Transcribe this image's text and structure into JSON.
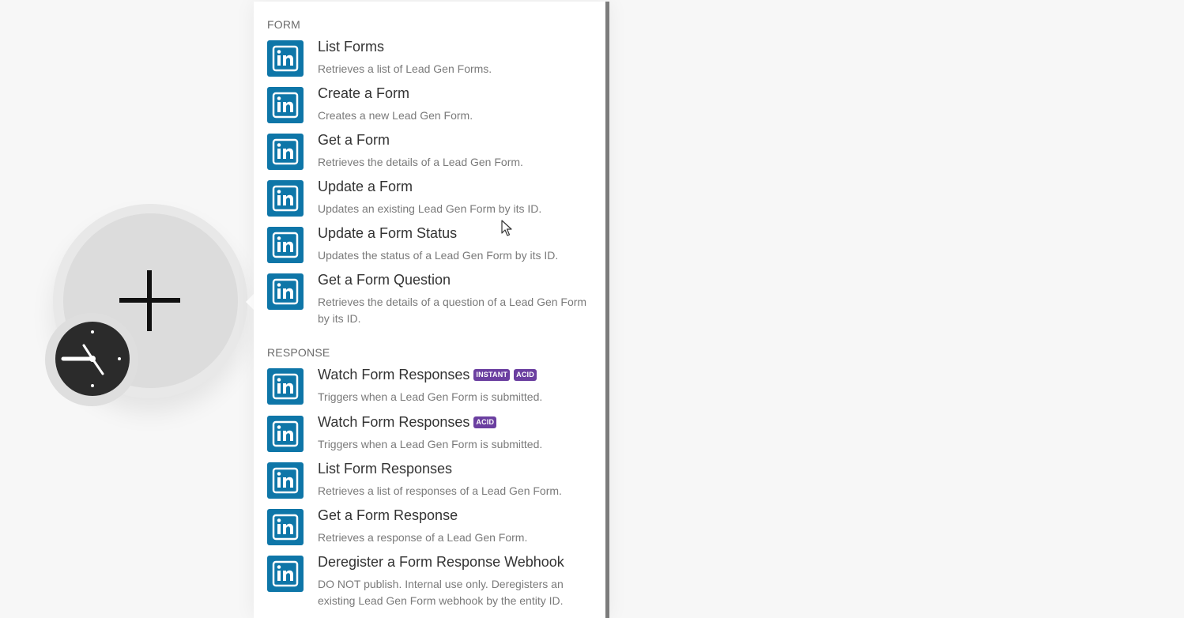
{
  "colors": {
    "linkedin_blue": "#0e76a8",
    "badge_purple": "#6b3fa0",
    "canvas_bg": "#f7f7f7"
  },
  "module": {
    "add_icon": "plus-icon",
    "trigger_icon": "clock-icon"
  },
  "sections": [
    {
      "header": "FORM",
      "items": [
        {
          "title": "List Forms",
          "desc": "Retrieves a list of Lead Gen Forms.",
          "icon": "linkedin-icon"
        },
        {
          "title": "Create a Form",
          "desc": "Creates a new Lead Gen Form.",
          "icon": "linkedin-icon"
        },
        {
          "title": "Get a Form",
          "desc": "Retrieves the details of a Lead Gen Form.",
          "icon": "linkedin-icon"
        },
        {
          "title": "Update a Form",
          "desc": "Updates an existing Lead Gen Form by its ID.",
          "icon": "linkedin-icon"
        },
        {
          "title": "Update a Form Status",
          "desc": "Updates the status of a Lead Gen Form by its ID.",
          "icon": "linkedin-icon"
        },
        {
          "title": "Get a Form Question",
          "desc": "Retrieves the details of a question of a Lead Gen Form by its ID.",
          "icon": "linkedin-icon"
        }
      ]
    },
    {
      "header": "RESPONSE",
      "items": [
        {
          "title": "Watch Form Responses",
          "badges": [
            "INSTANT",
            "ACID"
          ],
          "desc": "Triggers when a Lead Gen Form is submitted.",
          "icon": "linkedin-icon"
        },
        {
          "title": "Watch Form Responses",
          "badges": [
            "ACID"
          ],
          "desc": "Triggers when a Lead Gen Form is submitted.",
          "icon": "linkedin-icon"
        },
        {
          "title": "List Form Responses",
          "desc": "Retrieves a list of responses of a Lead Gen Form.",
          "icon": "linkedin-icon"
        },
        {
          "title": "Get a Form Response",
          "desc": "Retrieves a response of a Lead Gen Form.",
          "icon": "linkedin-icon"
        },
        {
          "title": "Deregister a Form Response Webhook",
          "desc": "DO NOT publish. Internal use only. Deregisters an existing Lead Gen Form webhook by the entity ID.",
          "icon": "linkedin-icon"
        }
      ]
    }
  ]
}
